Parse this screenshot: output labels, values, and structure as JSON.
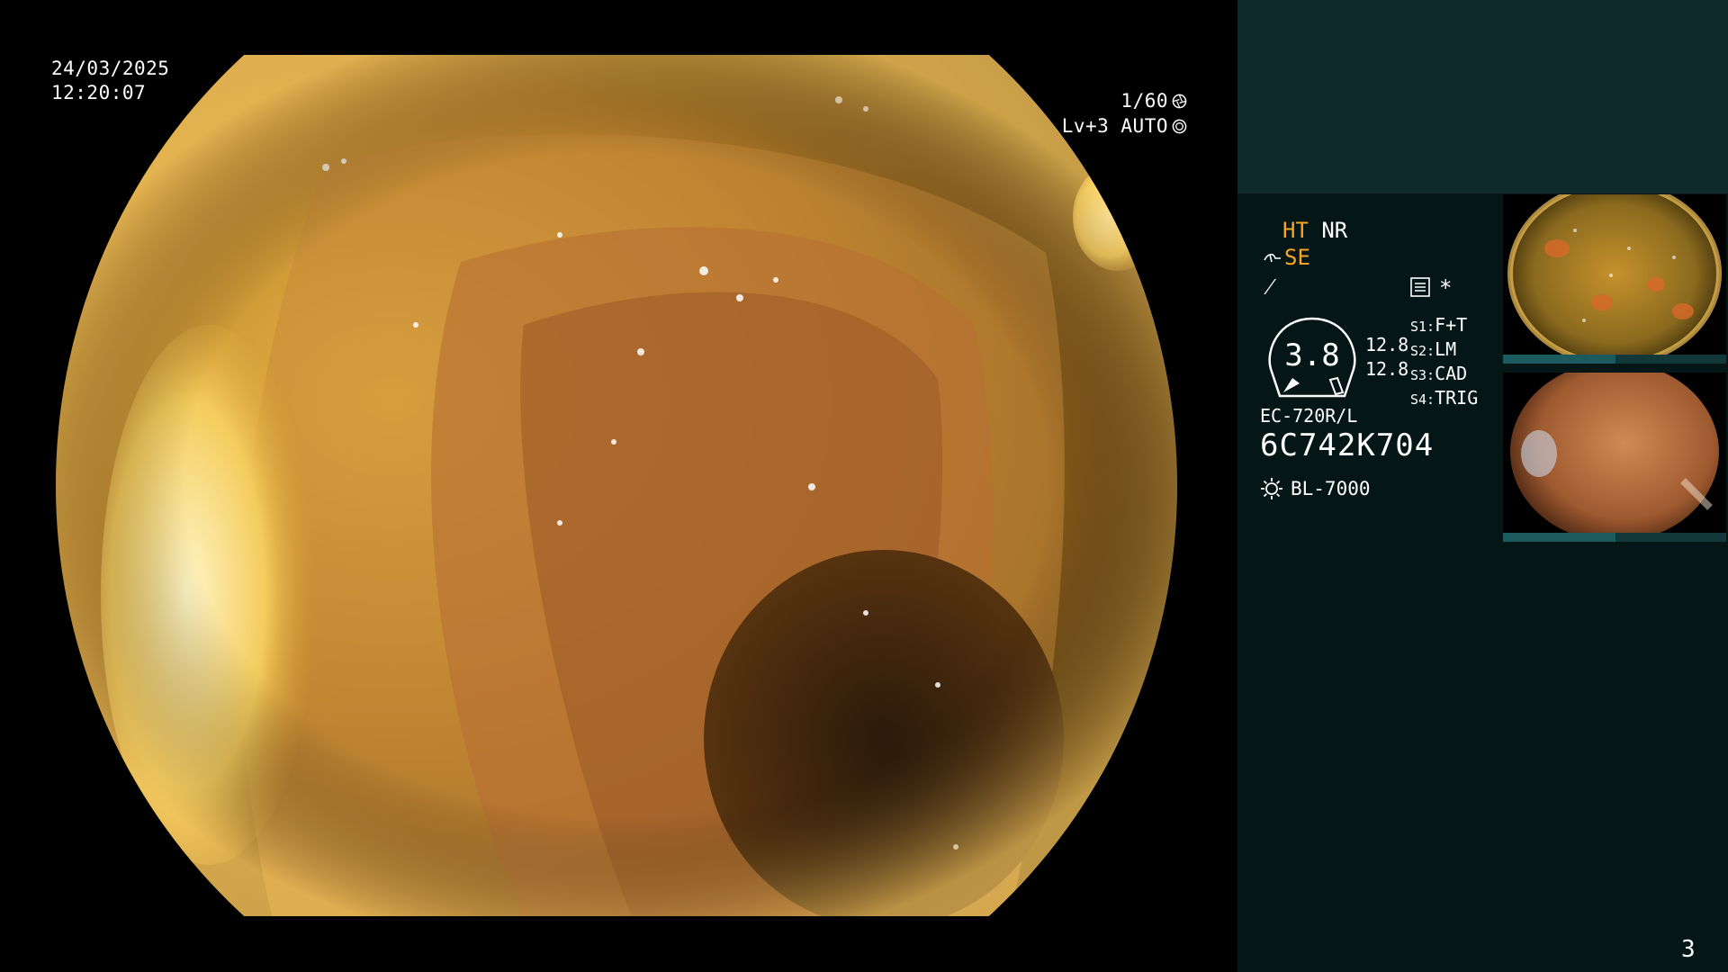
{
  "overlay": {
    "date": "24/03/2025",
    "time": "12:20:07",
    "shutter": "1/60",
    "level": "Lv+3 AUTO"
  },
  "panel": {
    "ht": "HT",
    "nr": "NR",
    "se": "SE",
    "f_symbol": "⁄",
    "asterisk": "*",
    "gauge_value": "3.8",
    "g_value_1": "12.8",
    "g_value_2": "12.8",
    "s_items": [
      {
        "key": "S1:",
        "value": "F+T"
      },
      {
        "key": "S2:",
        "value": "LM"
      },
      {
        "key": "S3:",
        "value": "CAD"
      },
      {
        "key": "S4:",
        "value": "TRIG"
      }
    ],
    "model": "EC-720R/L",
    "serial": "6C742K704",
    "light_source": "BL-7000"
  },
  "page_number": "3",
  "colors": {
    "accent": "#f5a623",
    "panel_bg": "#051617",
    "panel_top": "#0f2a2c"
  },
  "icons": [
    "aperture-icon",
    "target-icon",
    "menu-icon",
    "sun-icon",
    "scope-angle-icon"
  ]
}
